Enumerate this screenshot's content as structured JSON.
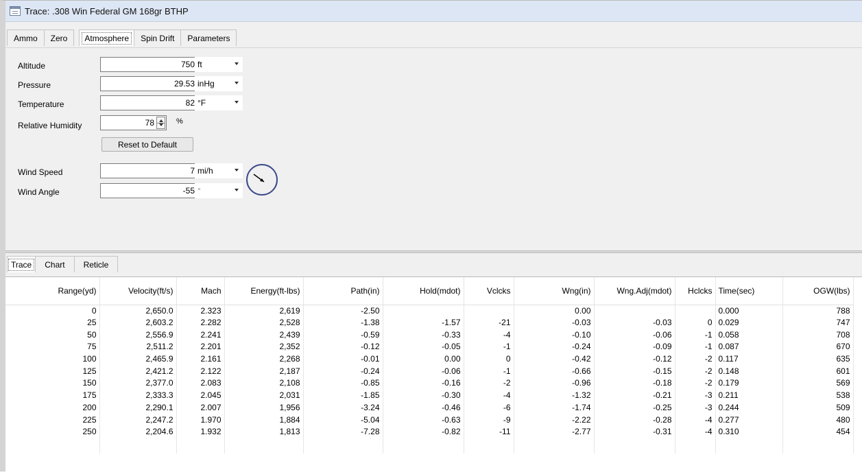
{
  "window": {
    "title": "Trace: .308 Win Federal GM 168gr BTHP"
  },
  "top_tabs": [
    {
      "label": "Ammo",
      "active": false
    },
    {
      "label": "Zero",
      "active": false
    },
    {
      "label": "Atmosphere",
      "active": true
    },
    {
      "label": "Spin Drift",
      "active": false
    },
    {
      "label": "Parameters",
      "active": false
    }
  ],
  "atmosphere": {
    "altitude": {
      "label": "Altitude",
      "value": "750",
      "unit": "ft"
    },
    "pressure": {
      "label": "Pressure",
      "value": "29.53",
      "unit": "inHg"
    },
    "temperature": {
      "label": "Temperature",
      "value": "82",
      "unit": "°F"
    },
    "humidity": {
      "label": "Relative Humidity",
      "value": "78",
      "unit": "%"
    },
    "reset_button": "Reset to Default",
    "wind_speed": {
      "label": "Wind Speed",
      "value": "7",
      "unit": "mi/h"
    },
    "wind_angle": {
      "label": "Wind Angle",
      "value": "-55",
      "unit": "°"
    }
  },
  "bottom_tabs": [
    {
      "label": "Trace",
      "active": true
    },
    {
      "label": "Chart",
      "active": false
    },
    {
      "label": "Reticle",
      "active": false
    }
  ],
  "trace_table": {
    "columns": [
      "Range(yd)",
      "Velocity(ft/s)",
      "Mach",
      "Energy(ft-lbs)",
      "Path(in)",
      "Hold(mdot)",
      "Vclcks",
      "Wng(in)",
      "Wng.Adj(mdot)",
      "Hclcks",
      "Time(sec)",
      "OGW(lbs)"
    ],
    "rows": [
      [
        "0",
        "2,650.0",
        "2.323",
        "2,619",
        "-2.50",
        "",
        "",
        "0.00",
        "",
        "",
        "0.000",
        "788"
      ],
      [
        "25",
        "2,603.2",
        "2.282",
        "2,528",
        "-1.38",
        "-1.57",
        "-21",
        "-0.03",
        "-0.03",
        "0",
        "0.029",
        "747"
      ],
      [
        "50",
        "2,556.9",
        "2.241",
        "2,439",
        "-0.59",
        "-0.33",
        "-4",
        "-0.10",
        "-0.06",
        "-1",
        "0.058",
        "708"
      ],
      [
        "75",
        "2,511.2",
        "2.201",
        "2,352",
        "-0.12",
        "-0.05",
        "-1",
        "-0.24",
        "-0.09",
        "-1",
        "0.087",
        "670"
      ],
      [
        "100",
        "2,465.9",
        "2.161",
        "2,268",
        "-0.01",
        "0.00",
        "0",
        "-0.42",
        "-0.12",
        "-2",
        "0.117",
        "635"
      ],
      [
        "125",
        "2,421.2",
        "2.122",
        "2,187",
        "-0.24",
        "-0.06",
        "-1",
        "-0.66",
        "-0.15",
        "-2",
        "0.148",
        "601"
      ],
      [
        "150",
        "2,377.0",
        "2.083",
        "2,108",
        "-0.85",
        "-0.16",
        "-2",
        "-0.96",
        "-0.18",
        "-2",
        "0.179",
        "569"
      ],
      [
        "175",
        "2,333.3",
        "2.045",
        "2,031",
        "-1.85",
        "-0.30",
        "-4",
        "-1.32",
        "-0.21",
        "-3",
        "0.211",
        "538"
      ],
      [
        "200",
        "2,290.1",
        "2.007",
        "1,956",
        "-3.24",
        "-0.46",
        "-6",
        "-1.74",
        "-0.25",
        "-3",
        "0.244",
        "509"
      ],
      [
        "225",
        "2,247.2",
        "1.970",
        "1,884",
        "-5.04",
        "-0.63",
        "-9",
        "-2.22",
        "-0.28",
        "-4",
        "0.277",
        "480"
      ],
      [
        "250",
        "2,204.6",
        "1.932",
        "1,813",
        "-7.28",
        "-0.82",
        "-11",
        "-2.77",
        "-0.31",
        "-4",
        "0.310",
        "454"
      ]
    ]
  },
  "colors": {
    "title_bar": "#dde6f4",
    "dial_border": "#3b4a8a"
  }
}
